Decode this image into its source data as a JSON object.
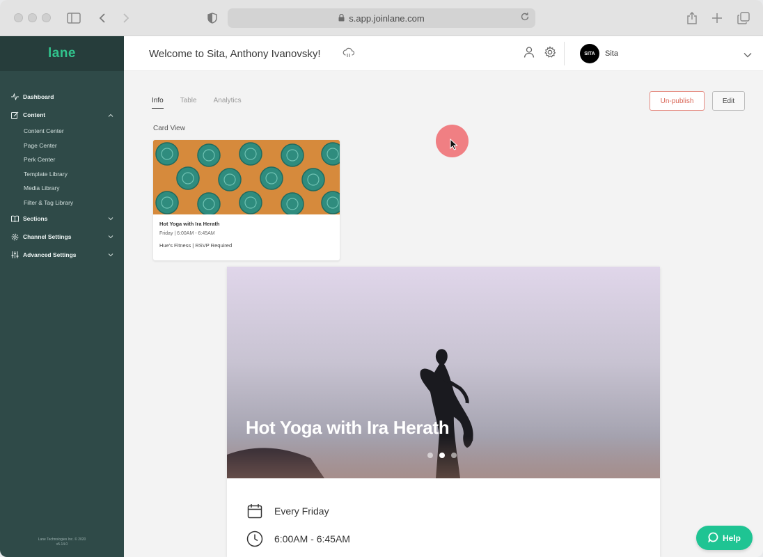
{
  "browser": {
    "url": "s.app.joinlane.com"
  },
  "sidebar": {
    "logo": "lane",
    "items": [
      {
        "label": "Dashboard",
        "icon": "activity-icon"
      },
      {
        "label": "Content",
        "icon": "edit-icon",
        "expanded": true
      },
      {
        "label": "Sections",
        "icon": "book-icon"
      },
      {
        "label": "Channel Settings",
        "icon": "gear-icon"
      },
      {
        "label": "Advanced Settings",
        "icon": "sliders-icon"
      }
    ],
    "content_subitems": [
      "Content Center",
      "Page Center",
      "Perk Center",
      "Template Library",
      "Media Library",
      "Filter & Tag Library"
    ],
    "footer_line1": "Lane Technologies Inc. © 2020",
    "footer_line2": "v5.14.0"
  },
  "header": {
    "welcome": "Welcome to Sita, Anthony Ivanovsky!",
    "avatar_text": "SITA",
    "org_name": "Sita"
  },
  "main": {
    "tabs": [
      "Info",
      "Table",
      "Analytics"
    ],
    "active_tab": "Info",
    "unpublish_label": "Un-publish",
    "edit_label": "Edit",
    "card_view_label": "Card View",
    "card": {
      "title": "Hot Yoga with Ira Herath",
      "time": "Friday | 6:00AM - 6:45AM",
      "location": "Hue's Fitness | RSVP Required"
    },
    "preview": {
      "title": "Hot Yoga with Ira Herath",
      "slide_count": 3,
      "active_slide": 2,
      "schedule": "Every Friday",
      "time": "6:00AM - 6:45AM"
    }
  },
  "help_label": "Help",
  "colors": {
    "sidebar_bg": "#2f4a48",
    "brand_green": "#31c48d",
    "help_green": "#1fc493",
    "unpublish_red": "#d96656",
    "cursor_highlight": "#f07f83"
  }
}
